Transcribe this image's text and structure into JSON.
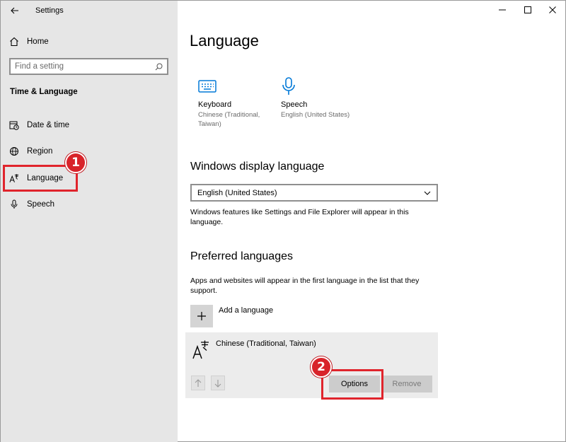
{
  "window": {
    "app_title": "Settings"
  },
  "sidebar": {
    "home_label": "Home",
    "search_placeholder": "Find a setting",
    "section_heading": "Time & Language",
    "items": [
      {
        "label": "Date & time",
        "icon": "calendar-clock-icon"
      },
      {
        "label": "Region",
        "icon": "globe-icon"
      },
      {
        "label": "Language",
        "icon": "language-icon",
        "selected": true
      },
      {
        "label": "Speech",
        "icon": "microphone-icon"
      }
    ]
  },
  "main": {
    "title": "Language",
    "tiles": [
      {
        "label": "Keyboard",
        "sub": "Chinese (Traditional, Taiwan)",
        "icon": "keyboard-icon"
      },
      {
        "label": "Speech",
        "sub": "English (United States)",
        "icon": "microphone-icon"
      }
    ],
    "display_language": {
      "heading": "Windows display language",
      "selected": "English (United States)",
      "description": "Windows features like Settings and File Explorer will appear in this language."
    },
    "preferred": {
      "heading": "Preferred languages",
      "description": "Apps and websites will appear in the first language in the list that they support.",
      "add_label": "Add a language",
      "languages": [
        {
          "name": "Chinese (Traditional, Taiwan)"
        }
      ],
      "options_label": "Options",
      "remove_label": "Remove"
    }
  },
  "annotations": {
    "badge_1": "1",
    "badge_2": "2"
  },
  "colors": {
    "accent": "#0078d7",
    "callout": "#e0242c",
    "sidebar_bg": "#e6e6e6"
  }
}
